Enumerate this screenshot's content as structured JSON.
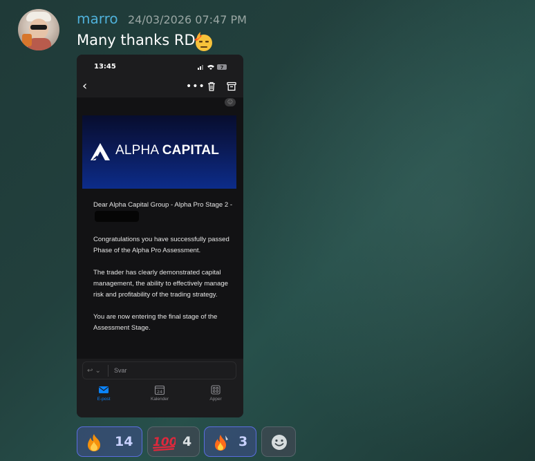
{
  "message": {
    "author": "marro",
    "timestamp": "24/03/2026 07:47 PM",
    "text": "Many thanks RD",
    "emoji": "saluting-face-with-fire-emoji"
  },
  "phone": {
    "status_time": "13:45",
    "battery": "7",
    "banner": {
      "brand_light": "ALPHA",
      "brand_bold": "CAPITAL"
    },
    "mail_paragraphs": {
      "p1": "Dear Alpha Capital Group - Alpha Pro Stage 2 -",
      "p2": "Congratulations you have successfully passed Phase of the Alpha Pro Assessment.",
      "p3": "The trader has clearly demonstrated capital management, the ability to effectively manage risk and profitability of the trading strategy.",
      "p4": "You are now entering the final stage of the Assessment Stage."
    },
    "reply_placeholder": "Svar",
    "tabs": {
      "mail": "E-post",
      "calendar": "Kalender",
      "calendar_day": "24",
      "apps": "Apper"
    }
  },
  "reactions": [
    {
      "emoji": "fire-emoji",
      "count": "14",
      "selected": true
    },
    {
      "emoji": "hundred-points-emoji",
      "count": "4",
      "selected": false
    },
    {
      "emoji": "custom-fire-emoji",
      "count": "3",
      "selected": true
    }
  ],
  "colors": {
    "username": "#4fb0d9",
    "selected_reaction_border": "#5b6de0",
    "accent_blue": "#0a84ff"
  }
}
